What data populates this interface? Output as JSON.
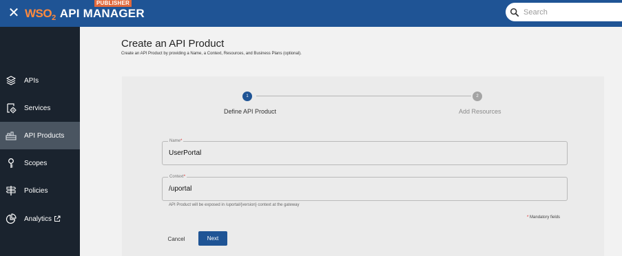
{
  "header": {
    "close_icon": "close-icon",
    "logo_wso": "WSO",
    "logo_two": "2",
    "app_name": "API MANAGER",
    "badge": "PUBLISHER",
    "search_placeholder": "Search",
    "colors": {
      "bar": "#1f5495",
      "logo": "#ff8a3d",
      "badge": "#e2693c"
    }
  },
  "sidebar": {
    "items": [
      {
        "label": "APIs",
        "icon": "layers-icon",
        "active": false
      },
      {
        "label": "Services",
        "icon": "service-gear-icon",
        "active": false
      },
      {
        "label": "API Products",
        "icon": "api-products-icon",
        "active": true
      },
      {
        "label": "Scopes",
        "icon": "scope-key-icon",
        "active": false
      },
      {
        "label": "Policies",
        "icon": "signpost-icon",
        "active": false
      },
      {
        "label": "Analytics",
        "icon": "analytics-pie-icon",
        "active": false,
        "external": "external-link-icon"
      }
    ]
  },
  "main": {
    "title": "Create an API Product",
    "subtitle": "Create an API Product by providing a Name, a Context, Resources, and Business Plans (optional).",
    "stepper": {
      "steps": [
        {
          "number": "1",
          "label": "Define API Product",
          "active": true
        },
        {
          "number": "2",
          "label": "Add Resources",
          "active": false
        }
      ]
    },
    "form": {
      "name_label": "Name",
      "name_value": "UserPortal",
      "context_label": "Context",
      "context_value": "/uportal",
      "required_mark": "*",
      "helper": "API Product will be exposed in /uportal/{version} context at the gateway",
      "mandatory_note": "Mandatory fields"
    },
    "actions": {
      "cancel": "Cancel",
      "next": "Next"
    }
  }
}
